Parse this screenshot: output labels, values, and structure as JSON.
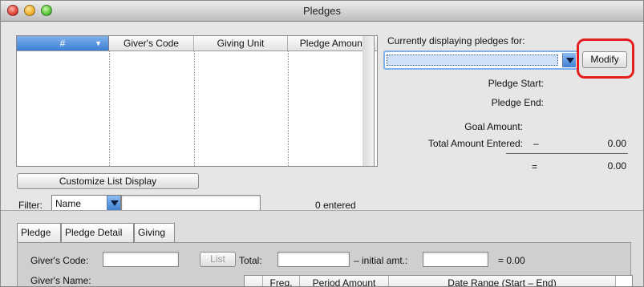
{
  "window": {
    "title": "Pledges"
  },
  "pledge_list": {
    "columns": [
      "#",
      "Giver's Code",
      "Giving Unit",
      "Pledge Amount"
    ],
    "rows": []
  },
  "customize_button": "Customize List Display",
  "filter": {
    "label": "Filter:",
    "selected": "Name",
    "value": ""
  },
  "entered_count": "0 entered",
  "display": {
    "heading": "Currently displaying pledges for:",
    "selected": "",
    "modify_label": "Modify"
  },
  "summary": {
    "pledge_start_label": "Pledge Start:",
    "pledge_end_label": "Pledge End:",
    "goal_label": "Goal Amount:",
    "total_label": "Total Amount Entered:",
    "minus_sign": "–",
    "total_value": "0.00",
    "equals_sign": "=",
    "result_value": "0.00"
  },
  "tabs": [
    "Pledge",
    "Pledge Detail",
    "Giving"
  ],
  "pledge_form": {
    "givers_code_label": "Giver's Code:",
    "givers_code_value": "",
    "list_button": "List",
    "total_label": "Total:",
    "total_value": "",
    "initial_label": "– initial amt.:",
    "initial_value": "",
    "equals_text": "= 0.00",
    "givers_name_label": "Giver's Name:"
  },
  "schedule_columns": [
    "",
    "Freq.",
    "Period Amount",
    "Date Range (Start – End)"
  ],
  "colors": {
    "accent": "#3d7fd4",
    "highlight": "#e41e1e"
  }
}
